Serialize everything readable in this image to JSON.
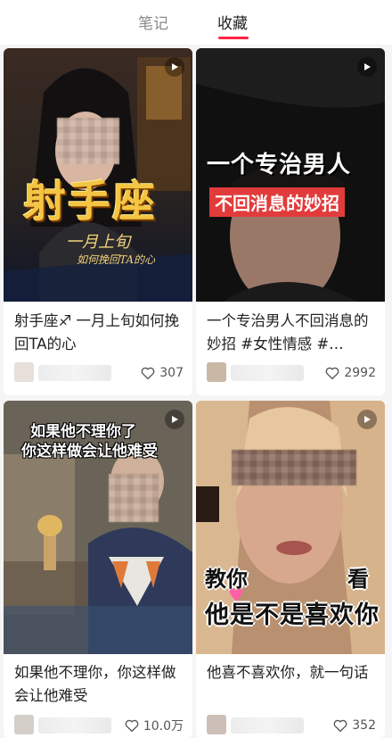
{
  "tabs": [
    {
      "label": "笔记",
      "active": false
    },
    {
      "label": "收藏",
      "active": true
    }
  ],
  "accent_color": "#ff2442",
  "posts": [
    {
      "cover_title": "射手座",
      "cover_subtitle": "一月上旬",
      "cover_caption": "如何挽回TA的心",
      "title": "射手座♐ 一月上旬如何挽回TA的心",
      "likes": "307"
    },
    {
      "cover_line1": "一个专治男人",
      "cover_line2": "不回消息的妙招",
      "title": "一个专治男人不回消息的妙招 #女性情感 #…",
      "likes": "2992"
    },
    {
      "cover_line1": "如果他不理你了",
      "cover_line2": "你这样做会让他难受",
      "title": "如果他不理你，你这样做会让他难受",
      "likes": "10.0万"
    },
    {
      "cover_line1a": "教你",
      "cover_line1b": "看",
      "cover_line2": "他是不是喜欢你",
      "title": "他喜不喜欢你，就一句话",
      "likes": "352"
    }
  ],
  "icons": {
    "play": "play-icon",
    "heart": "heart-icon"
  }
}
